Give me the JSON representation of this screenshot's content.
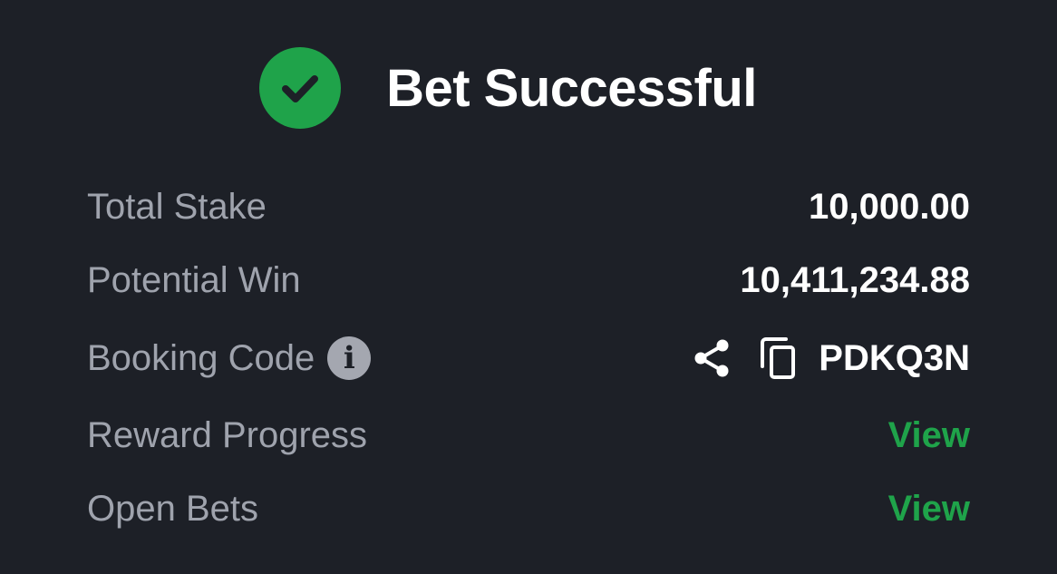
{
  "header": {
    "title": "Bet Successful",
    "icon": "check-circle-icon",
    "icon_color": "#1fa34a"
  },
  "summary": {
    "total_stake_label": "Total Stake",
    "total_stake_value": "10,000.00",
    "potential_win_label": "Potential Win",
    "potential_win_value": "10,411,234.88",
    "booking_code_label": "Booking Code",
    "booking_code_info_icon": "info-icon",
    "booking_code_value": "PDKQ3N",
    "share_icon": "share-icon",
    "copy_icon": "copy-icon",
    "reward_progress_label": "Reward Progress",
    "reward_progress_link": "View",
    "open_bets_label": "Open Bets",
    "open_bets_link": "View"
  },
  "colors": {
    "background": "#1d2027",
    "accent_green": "#1fa34a",
    "label_gray": "#9fa3ad"
  }
}
